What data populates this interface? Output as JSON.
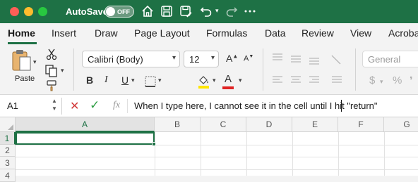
{
  "titlebar": {
    "autosave_label": "AutoSave",
    "autosave_state": "OFF",
    "colors": {
      "bar": "#1e7145",
      "close": "#ff5f57",
      "minimize": "#febc2e",
      "zoom": "#28c840"
    },
    "icons": [
      "home-icon",
      "save-icon",
      "save-as-icon",
      "undo-icon",
      "redo-icon",
      "more-icon"
    ]
  },
  "tabs": [
    "Home",
    "Insert",
    "Draw",
    "Page Layout",
    "Formulas",
    "Data",
    "Review",
    "View",
    "Acroba"
  ],
  "active_tab": "Home",
  "ribbon": {
    "paste_label": "Paste",
    "font_name": "Calibri (Body)",
    "font_size": "12",
    "number_format": "General",
    "bold": "B",
    "italic": "I",
    "underline": "U",
    "font_color_letter": "A",
    "currency_symbol": "$",
    "percent_symbol": "%",
    "font_color": "#e02424",
    "highlight_color": "#ffe600"
  },
  "formula_bar": {
    "name_box": "A1",
    "fx_label": "fx",
    "cancel_symbol": "✕",
    "enter_symbol": "✓",
    "content": "When I type here, I cannot see it in the cell until I hit \"return\""
  },
  "sheet": {
    "columns": [
      "A",
      "B",
      "C",
      "D",
      "E",
      "F",
      "G"
    ],
    "rows": [
      "1",
      "2",
      "3",
      "4"
    ],
    "selected_cell": "A1"
  }
}
